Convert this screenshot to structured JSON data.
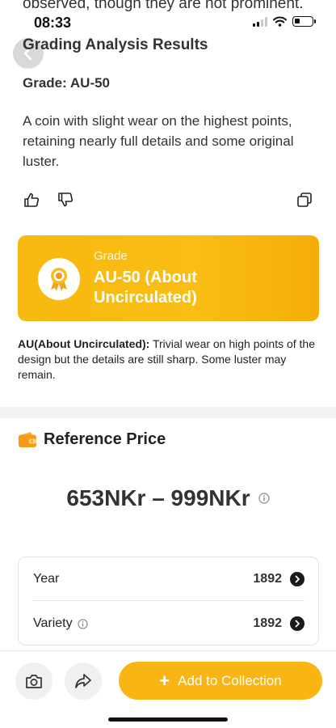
{
  "status_bar": {
    "time": "08:33"
  },
  "cut_text": "observed, though they are not prominent.",
  "analysis": {
    "title": "Grading Analysis Results",
    "grade_line": "Grade: AU-50",
    "description": "A coin with slight wear on the highest points, retaining nearly full details and some original luster."
  },
  "actions": {
    "like_icon": "thumbs-up-icon",
    "dislike_icon": "thumbs-down-icon",
    "copy_icon": "copy-icon"
  },
  "grade_card": {
    "label": "Grade",
    "value": "AU-50 (About Uncirculated)",
    "icon": "award-badge-icon",
    "colors": {
      "bg": "#f9bd14",
      "text": "#ffffff"
    }
  },
  "grade_note": {
    "term": "AU(About Uncirculated):",
    "text": " Trivial wear on high points of the design but the details are still sharp. Some luster may remain."
  },
  "reference": {
    "title": "Reference Price",
    "icon": "wallet-icon",
    "price_range": "653NKr – 999NKr",
    "info_icon": "info-icon"
  },
  "details": [
    {
      "label": "Year",
      "value": "1892",
      "has_info": false
    },
    {
      "label": "Variety",
      "value": "1892",
      "has_info": true
    }
  ],
  "bottom_bar": {
    "camera_icon": "camera-icon",
    "share_icon": "share-icon",
    "add_button_label": "Add to Collection",
    "accent": "#f8b514"
  }
}
